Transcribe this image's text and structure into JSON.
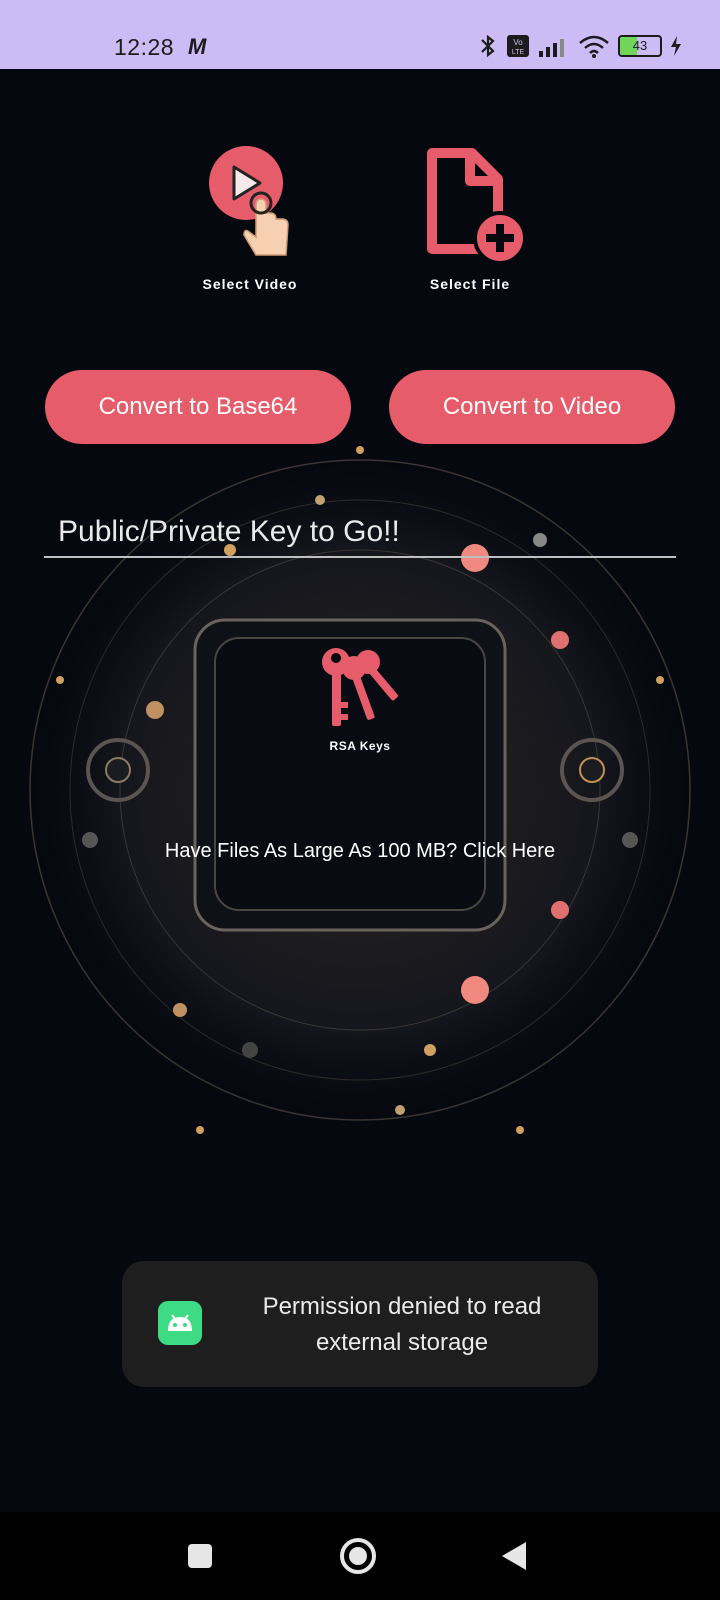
{
  "status_bar": {
    "time": "12:28",
    "carrier_icon": "M",
    "battery_level": "43",
    "icons": [
      "bluetooth-icon",
      "volte-icon",
      "signal-icon",
      "wifi-icon",
      "battery-icon",
      "charging-icon"
    ]
  },
  "actions": {
    "select_video_label": "Select Video",
    "select_file_label": "Select File"
  },
  "buttons": {
    "convert_base64": "Convert to Base64",
    "convert_video": "Convert to Video"
  },
  "key_input": {
    "value": "Public/Private Key to Go!!"
  },
  "rsa": {
    "label": "RSA Keys"
  },
  "large_files_link": "Have Files As Large As 100 MB? Click Here",
  "toast": {
    "message": "Permission denied to read external storage"
  },
  "colors": {
    "accent": "#e65c6a",
    "status_bar": "#cdbbf6",
    "background": "#06080f"
  }
}
